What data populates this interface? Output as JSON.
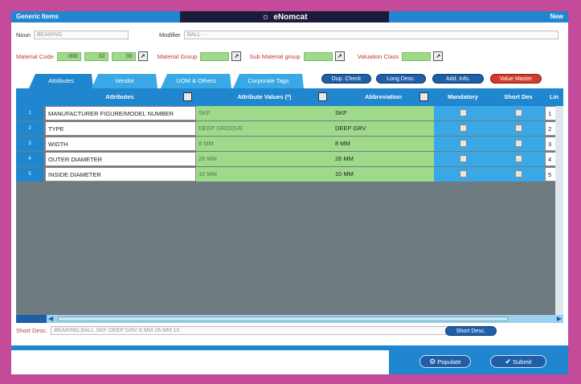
{
  "titlebar": {
    "left": "Generic Items",
    "brand": "eNomcat",
    "right": "New"
  },
  "form": {
    "noun_label": "Noun",
    "noun_value": "BEARING",
    "modifier_label": "Modifier",
    "modifier_value": "BALL - -",
    "material_code_label": "Material Code",
    "material_code": [
      "000",
      "02",
      "00"
    ],
    "material_group_label": "Material Group",
    "sub_material_group_label": "Sub Material group",
    "valuation_class_label": "Valuation Class"
  },
  "tabs": [
    "Attributes",
    "Vendor",
    "UOM & Others",
    "Corporate Tags"
  ],
  "actions": [
    "Dup. Check",
    "Long Desc.",
    "Add. Info.",
    "Value Master"
  ],
  "grid": {
    "headers": [
      "Attributes",
      "Attribute Values (*)",
      "Abbreviation",
      "Mandatory",
      "Short Des",
      "Lin"
    ],
    "rows": [
      {
        "num": "1",
        "attribute": "MANUFACTURER FIGURE/MODEL NUMBER",
        "value": "SKF",
        "abbr": "SKF",
        "line": "1"
      },
      {
        "num": "2",
        "attribute": "TYPE",
        "value": "DEEP GROOVE",
        "abbr": "DEEP GRV",
        "line": "2"
      },
      {
        "num": "3",
        "attribute": "WIDTH",
        "value": "8 MM",
        "abbr": "8 MM",
        "line": "3"
      },
      {
        "num": "4",
        "attribute": "OUTER DIAMETER",
        "value": "26 MM",
        "abbr": "26 MM",
        "line": "4"
      },
      {
        "num": "5",
        "attribute": "INSIDE DIAMETER",
        "value": "10 MM",
        "abbr": "10 MM",
        "line": "5"
      }
    ]
  },
  "short_desc": {
    "label": "Short Desc.",
    "value": "BEARING,BALL SKF DEEP GRV 8 MM 26 MM 10",
    "button": "Short Desc."
  },
  "footer": {
    "populate": "Populate",
    "submit": "Submit"
  },
  "colors": {
    "frame": "#c44a9a",
    "primary": "#1f86cf",
    "green_field": "#9fd98a",
    "value_master": "#d23a2a"
  }
}
